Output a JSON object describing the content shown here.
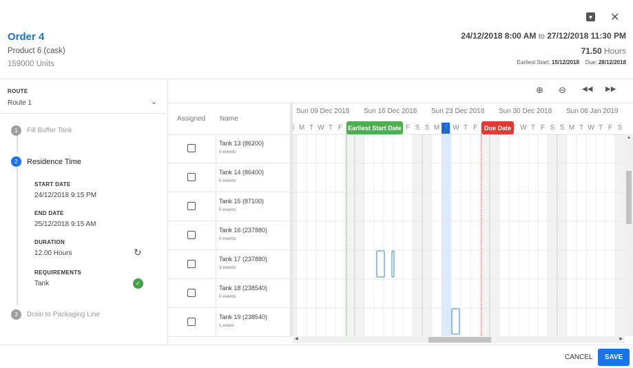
{
  "header": {
    "title": "Order 4",
    "product": "Product 6 (cask)",
    "units": "159000 Units",
    "range_start": "24/12/2018 8:00 AM",
    "range_to": "to",
    "range_end": "27/12/2018 11:30 PM",
    "hours_value": "71.50",
    "hours_unit": "Hours",
    "earliest_label": "Earliest Start:",
    "earliest_value": "15/12/2018",
    "due_label": "Due:",
    "due_value": "28/12/2018",
    "icons": [
      "archive-icon",
      "close-icon"
    ]
  },
  "route": {
    "label": "ROUTE",
    "value": "Route 1"
  },
  "steps": [
    {
      "num": "1",
      "name": "Fill Buffer Tank"
    },
    {
      "num": "2",
      "name": "Residence Time",
      "active": true,
      "start_label": "START DATE",
      "start_value": "24/12/2018 9:15 PM",
      "end_label": "END DATE",
      "end_value": "25/12/2018 9:15 AM",
      "duration_label": "DURATION",
      "duration_value": "12.00 Hours",
      "req_label": "REQUIREMENTS",
      "req_value": "Tank"
    },
    {
      "num": "3",
      "name": "Drain to Packaging Line"
    }
  ],
  "table": {
    "headers": {
      "assigned": "Assigned",
      "name": "Name"
    },
    "rows": [
      {
        "name": "Tank 13 (86200)",
        "events": "0 events",
        "checked": false
      },
      {
        "name": "Tank 14 (86400)",
        "events": "0 events",
        "checked": false
      },
      {
        "name": "Tank 15 (87100)",
        "events": "0 events",
        "checked": false
      },
      {
        "name": "Tank 16 (237880)",
        "events": "0 events",
        "checked": false
      },
      {
        "name": "Tank 17 (237880)",
        "events": "3 events",
        "checked": false
      },
      {
        "name": "Tank 18 (238540)",
        "events": "0 events",
        "checked": false
      },
      {
        "name": "Tank 19 (238540)",
        "events": "1 event",
        "checked": false
      }
    ]
  },
  "timeline": {
    "weeks": [
      "Sun 09 Dec 2018",
      "Sun 16 Dec 2018",
      "Sun 23 Dec 2018",
      "Sun 30 Dec 2018",
      "Sun 06 Jan 2019"
    ],
    "day_letters": [
      "S",
      "M",
      "T",
      "W",
      "T",
      "F",
      "S",
      "S",
      "M",
      "T",
      "W",
      "T",
      "F",
      "S",
      "S",
      "M",
      "T",
      "W",
      "T",
      "F",
      "S",
      "S",
      "M",
      "T",
      "W",
      "T",
      "F",
      "S",
      "S",
      "M",
      "T",
      "W",
      "T",
      "F",
      "S"
    ],
    "earliest_marker": "Earliest Start Date",
    "due_marker": "Due Date",
    "colors": {
      "earliest": "#4caf50",
      "due": "#e53935",
      "highlight": "#dcebf9",
      "event": "#5c9fe0",
      "accent": "#1a73e8"
    },
    "toolbar": [
      "zoom-in-icon",
      "zoom-out-icon",
      "rewind-icon",
      "fast-forward-icon"
    ]
  },
  "footer": {
    "cancel": "CANCEL",
    "save": "SAVE"
  }
}
